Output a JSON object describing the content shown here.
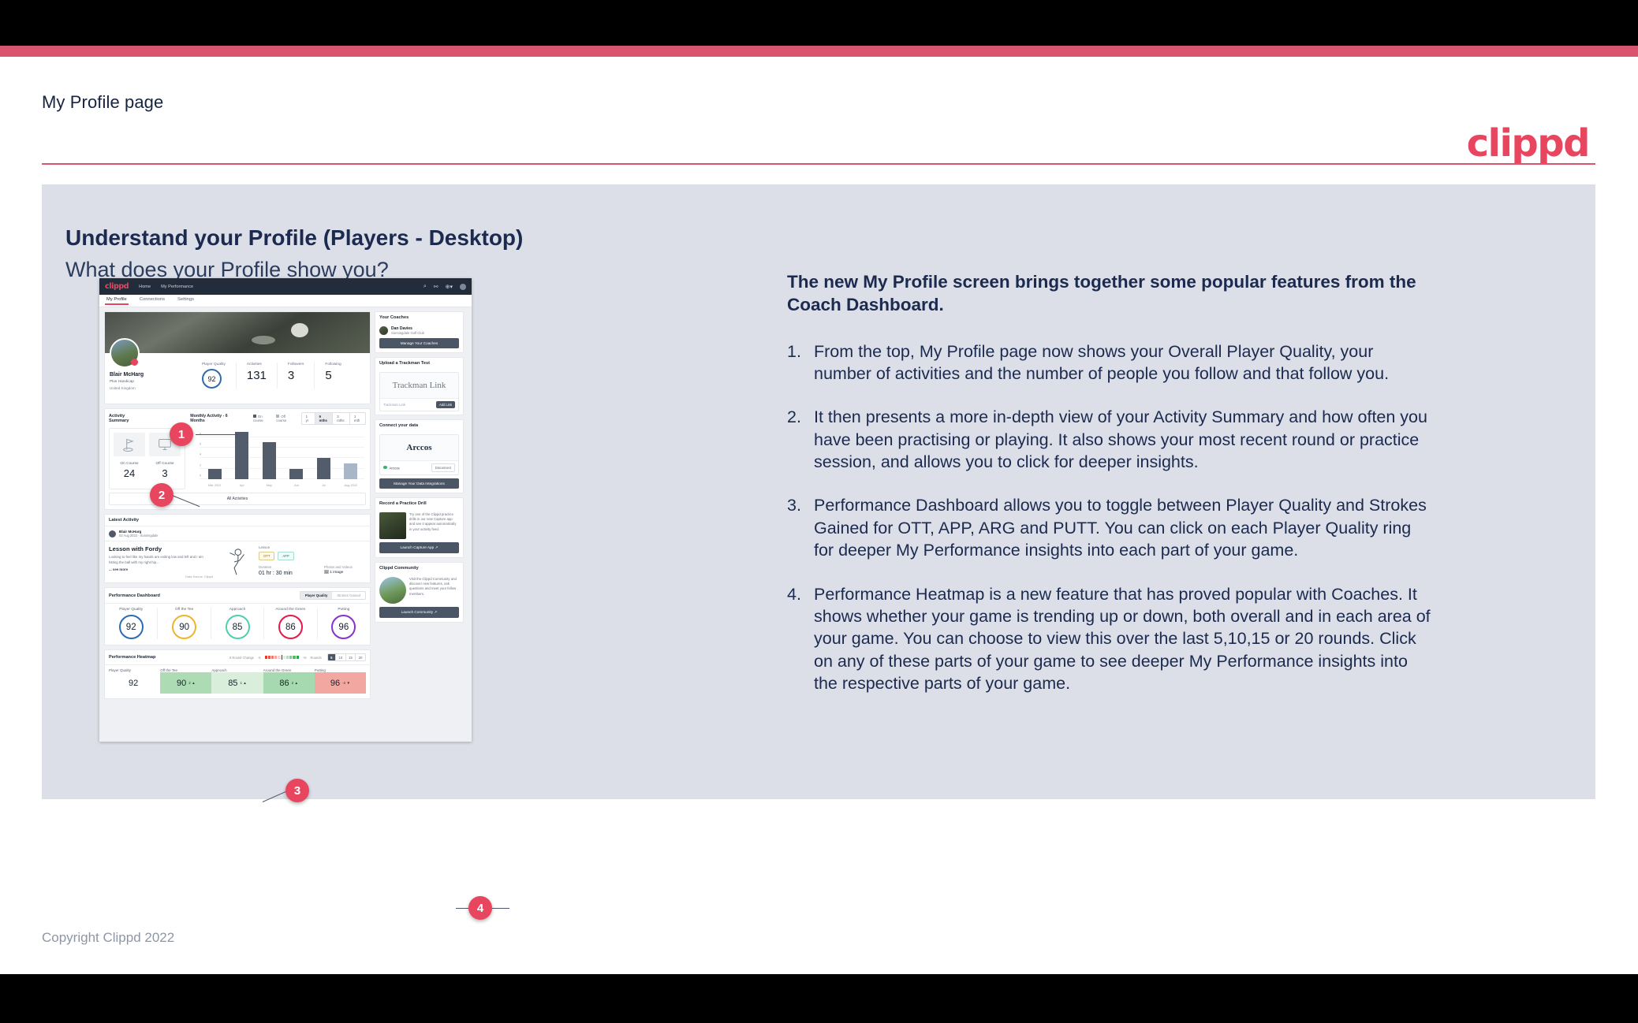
{
  "header": {
    "title": "My Profile page",
    "logo": "clippd",
    "logo_color": "#e8455f"
  },
  "slide": {
    "heading": "Understand your Profile (Players - Desktop)",
    "subheading": "What does your Profile show you?",
    "copyright": "Copyright Clippd 2022"
  },
  "notes": {
    "lead": "The new My Profile screen brings together some popular features from the Coach Dashboard.",
    "items": [
      {
        "num": "1.",
        "text": "From the top, My Profile page now shows your Overall Player Quality, your number of activities and the number of people you follow and that follow you."
      },
      {
        "num": "2.",
        "text": "It then presents a more in-depth view of your Activity Summary and how often you have been practising or playing. It also shows your most recent round or practice session, and allows you to click for deeper insights."
      },
      {
        "num": "3.",
        "text": "Performance Dashboard allows you to toggle between Player Quality and Strokes Gained for OTT, APP, ARG and PUTT. You can click on each Player Quality ring for deeper My Performance insights into each part of your game."
      },
      {
        "num": "4.",
        "text": "Performance Heatmap is a new feature that has proved popular with Coaches. It shows whether your game is trending up or down, both overall and in each area of your game. You can choose to view this over the last 5,10,15 or 20 rounds. Click on any of these parts of your game to see deeper My Performance insights into the respective parts of your game."
      }
    ]
  },
  "callouts": [
    "1",
    "2",
    "3",
    "4"
  ],
  "app": {
    "nav": {
      "logo": "clippd",
      "links": [
        "Home",
        "My Performance"
      ],
      "icons": [
        "search-icon",
        "community-icon",
        "add-icon",
        "avatar-icon"
      ]
    },
    "tabs": [
      {
        "label": "My Profile",
        "active": true
      },
      {
        "label": "Connections",
        "active": false
      },
      {
        "label": "Settings",
        "active": false
      }
    ],
    "profile": {
      "name": "Blair McHarg",
      "handicap": "Plus Handicap",
      "location": "United Kingdom",
      "stats": [
        {
          "label": "Player Quality",
          "value": "92",
          "ring": true,
          "color": "#2d6cb5"
        },
        {
          "label": "Activities",
          "value": "131"
        },
        {
          "label": "Followers",
          "value": "3"
        },
        {
          "label": "Following",
          "value": "5"
        }
      ]
    },
    "activity": {
      "title": "Activity Summary",
      "chart_title": "Monthly Activity - 6 Months",
      "legend": [
        {
          "label": "On course",
          "color": "#535c6b"
        },
        {
          "label": "Off course",
          "color": "#a9b6c8"
        }
      ],
      "ranges": [
        {
          "label": "1 yr",
          "active": false
        },
        {
          "label": "6 mths",
          "active": true
        },
        {
          "label": "3 mths",
          "active": false
        },
        {
          "label": "1 mth",
          "active": false
        }
      ],
      "tiles": [
        {
          "label": "On Course",
          "value": "24",
          "icon": "golf-flag-icon"
        },
        {
          "label": "Off Course",
          "value": "3",
          "icon": "monitor-icon"
        }
      ],
      "all_activities": "All Activities"
    },
    "latest": {
      "title": "Latest Activity",
      "user": "Blair McHarg",
      "meta": "03 Aug 2022 - Sunningdale",
      "headline": "Lesson with Fordy",
      "desc": "Looking to feel like my hands are exiting low and left and I am hitting the ball with my right hip...",
      "see_more": "... see more",
      "source": "Data Source: Clippd",
      "type_label": "Lesson",
      "tags": [
        "OTT",
        "APP"
      ],
      "duration_label": "Duration",
      "duration": "01 hr : 30 min",
      "media_label": "Photos and Videos",
      "media": "1 image"
    },
    "dashboard": {
      "title": "Performance Dashboard",
      "toggle": [
        {
          "label": "Player Quality",
          "active": true
        },
        {
          "label": "Strokes Gained",
          "active": false
        }
      ],
      "rings": [
        {
          "label": "Player Quality",
          "value": "92",
          "color": "#2d6cb5"
        },
        {
          "label": "Off the Tee",
          "value": "90",
          "color": "#f0b429"
        },
        {
          "label": "Approach",
          "value": "85",
          "color": "#4cd0b0"
        },
        {
          "label": "Around the Green",
          "value": "86",
          "color": "#e01b4c"
        },
        {
          "label": "Putting",
          "value": "96",
          "color": "#8b2fd0"
        }
      ]
    },
    "heatmap": {
      "title": "Performance Heatmap",
      "scale_label": "5 Round Change",
      "scale_min": "-5",
      "scale_max": "+5",
      "rounds_label": "Rounds",
      "rounds": [
        {
          "label": "5",
          "active": true
        },
        {
          "label": "10",
          "active": false
        },
        {
          "label": "15",
          "active": false
        },
        {
          "label": "20",
          "active": false
        }
      ],
      "cells": [
        {
          "label": "Player Quality",
          "value": "92",
          "delta": "",
          "bg": "#ffffff"
        },
        {
          "label": "Off the Tee",
          "value": "90",
          "delta": "2 ▲",
          "bg": "#addcb4"
        },
        {
          "label": "Approach",
          "value": "85",
          "delta": "1 ▲",
          "bg": "#d9efdc"
        },
        {
          "label": "Around the Green",
          "value": "86",
          "delta": "2 ▲",
          "bg": "#a7d9b0"
        },
        {
          "label": "Putting",
          "value": "96",
          "delta": "-2 ▼",
          "bg": "#f2a8a1"
        }
      ]
    },
    "sidebar": {
      "coaches": {
        "title": "Your Coaches",
        "name": "Dan Davies",
        "club": "Sunningdale Golf Club",
        "button": "Manage Your Coaches"
      },
      "trackman": {
        "title": "Upload a Trackman Test",
        "brand": "Trackman Link",
        "placeholder": "Trackman Link",
        "button": "Add Link"
      },
      "connect": {
        "title": "Connect your data",
        "brand": "Arccos",
        "status": "Arccos",
        "disconnect": "Disconnect",
        "button": "Manage Your Data Integrations"
      },
      "drill": {
        "title": "Record a Practice Drill",
        "text": "Try one of the Clippd practice drills in our new Capture app and see it appear automatically in your activity feed.",
        "button": "Launch Capture App"
      },
      "community": {
        "title": "Clippd Community",
        "text": "Visit the Clippd Community and discover new features, ask questions and meet your fellow members.",
        "button": "Launch Community"
      }
    }
  },
  "chart_data": {
    "type": "bar",
    "title": "Monthly Activity - 6 Months",
    "categories": [
      "Mar 2022",
      "Apr",
      "May",
      "Jun",
      "Jul",
      "Aug 2022"
    ],
    "values": [
      2,
      9,
      7,
      2,
      4,
      3
    ],
    "bar_colors": [
      "#535c6b",
      "#535c6b",
      "#535c6b",
      "#535c6b",
      "#535c6b",
      "#a9b6c8"
    ],
    "yticks": [
      0,
      2,
      4,
      6,
      8
    ],
    "ylim": [
      0,
      9.6
    ],
    "xlabel": "",
    "ylabel": "",
    "grid": true,
    "legend": [
      "On course",
      "Off course"
    ],
    "legend_position": "top"
  }
}
